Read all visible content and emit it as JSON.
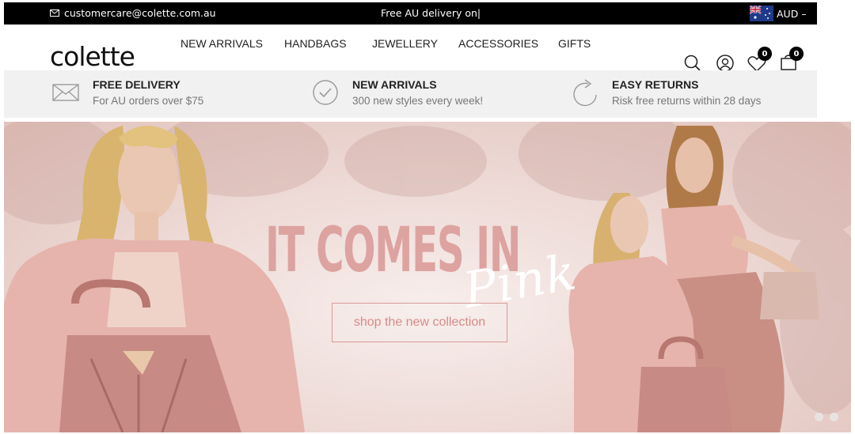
{
  "topbar": {
    "email": "customercare@colette.com.au",
    "promo": "Free AU delivery on|",
    "currency": "AUD –"
  },
  "header": {
    "logo": "colette",
    "nav": [
      "NEW ARRIVALS",
      "HANDBAGS",
      "JEWELLERY",
      "ACCESSORIES",
      "GIFTS"
    ],
    "wishlist_count": "0",
    "cart_count": "0"
  },
  "usp": [
    {
      "icon": "envelope-icon",
      "title": "FREE DELIVERY",
      "subtitle": "For AU orders over $75"
    },
    {
      "icon": "checkmark-circle-icon",
      "title": "NEW ARRIVALS",
      "subtitle": "300 new styles every week!"
    },
    {
      "icon": "return-arrow-icon",
      "title": "EASY RETURNS",
      "subtitle": "Risk free returns within 28 days"
    }
  ],
  "hero": {
    "headline": "IT COMES IN",
    "script": "Pink",
    "cta": "shop the new collection",
    "slides": 2
  },
  "colors": {
    "topbar_bg": "#000000",
    "usp_bg": "#f1f1f1",
    "hero_text": "#dda3a1",
    "cta_border": "#d99a98"
  }
}
